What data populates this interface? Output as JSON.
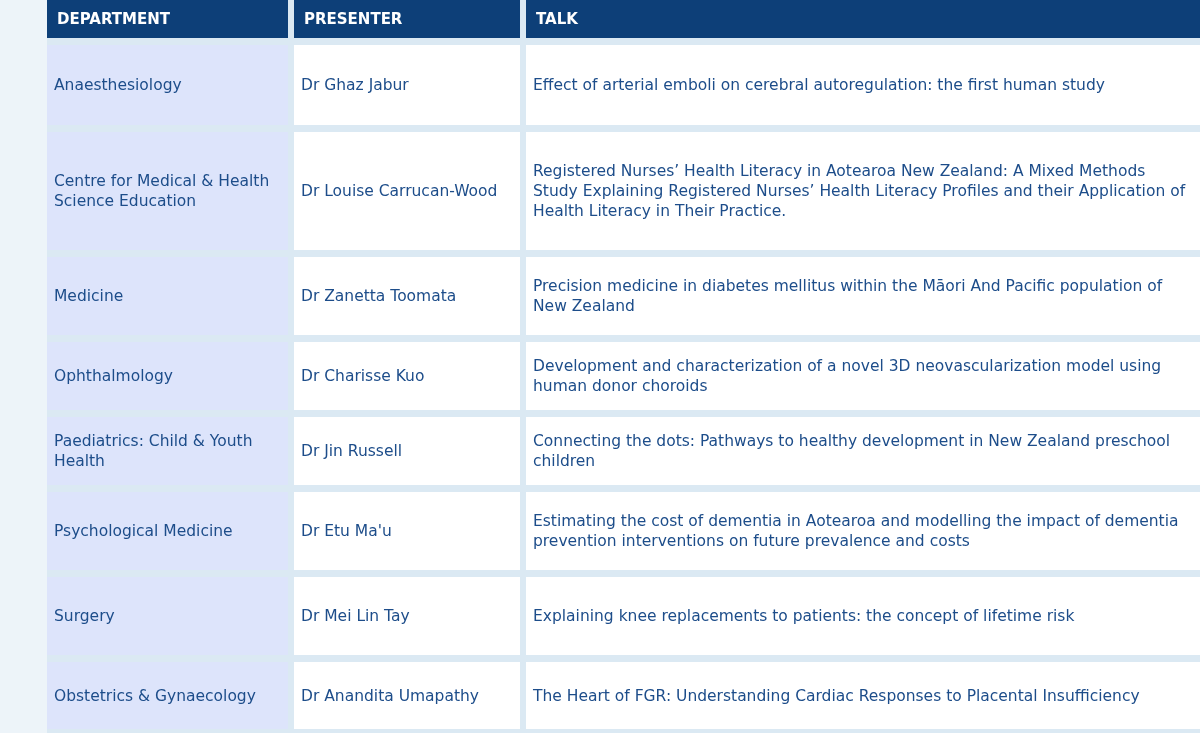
{
  "table": {
    "columns": [
      "DEPARTMENT",
      "PRESENTER",
      "TALK"
    ],
    "rows": [
      {
        "department": "Anaesthesiology",
        "presenter": "Dr Ghaz Jabur",
        "talk": "Effect of arterial emboli on cerebral autoregulation: the first human study"
      },
      {
        "department": "Centre for Medical & Health Science Education",
        "presenter": "Dr Louise Carrucan-Wood",
        "talk": "Registered Nurses’ Health Literacy in Aotearoa New Zealand: A Mixed Methods Study Explaining Registered Nurses’ Health Literacy Profiles and their Application of Health Literacy in Their Practice."
      },
      {
        "department": "Medicine",
        "presenter": "Dr Zanetta Toomata",
        "talk": "Precision medicine in diabetes mellitus within the Māori And Pacific population of New Zealand"
      },
      {
        "department": "Ophthalmology",
        "presenter": "Dr Charisse Kuo",
        "talk": "Development and characterization of a novel 3D neovascularization model using human donor choroids"
      },
      {
        "department": "Paediatrics: Child & Youth Health",
        "presenter": "Dr Jin Russell",
        "talk": "Connecting the dots: Pathways to healthy development in New Zealand preschool children"
      },
      {
        "department": "Psychological Medicine",
        "presenter": "Dr Etu Ma'u",
        "talk": "Estimating the cost of dementia in Aotearoa and modelling the impact of dementia prevention interventions on future prevalence and costs"
      },
      {
        "department": "Surgery",
        "presenter": "Dr Mei Lin Tay",
        "talk": "Explaining knee replacements to patients: the concept of lifetime risk"
      },
      {
        "department": "Obstetrics & Gynaecology",
        "presenter": "Dr Anandita Umapathy",
        "talk": "The Heart of FGR: Understanding Cardiac Responses to Placental Insufficiency"
      }
    ]
  }
}
